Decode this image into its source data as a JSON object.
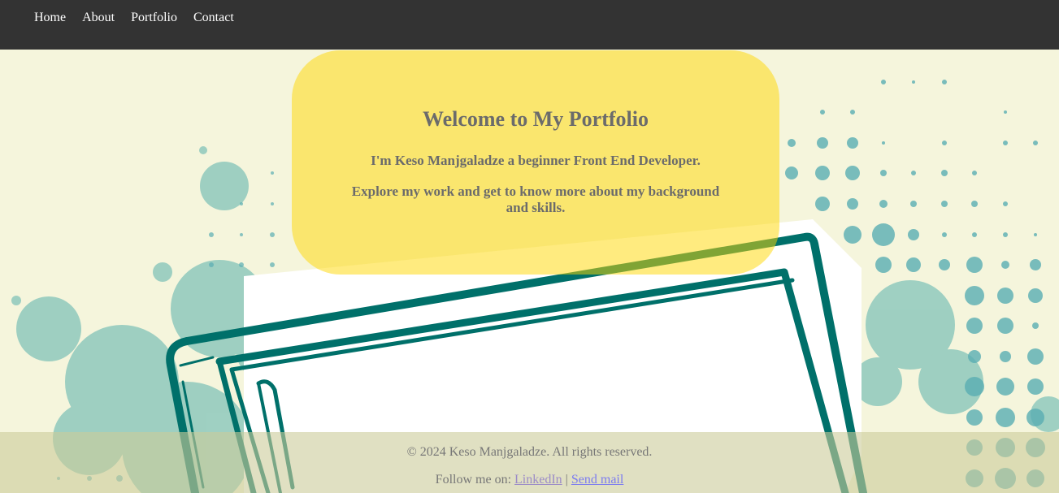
{
  "nav": {
    "items": [
      {
        "label": "Home"
      },
      {
        "label": "About"
      },
      {
        "label": "Portfolio"
      },
      {
        "label": "Contact"
      }
    ]
  },
  "hero": {
    "title": "Welcome to My Portfolio",
    "intro": "I'm Keso Manjgaladze a beginner Front End Developer.",
    "explore": "Explore my work and get to know more about my background and skills."
  },
  "footer": {
    "copyright": "© 2024 Keso Manjgaladze. All rights reserved.",
    "follow_label": "Follow me on:",
    "linkedin_label": "LinkedIn",
    "separator": "|",
    "mail_label": "Send mail"
  },
  "colors": {
    "nav_bg": "#333333",
    "page_bg": "#f5f5dc",
    "hero_bg": "#ffd700",
    "splash_teal": "#8fc9bd",
    "notebook_teal": "#00706a",
    "dot_teal": "#5aaeb3"
  }
}
